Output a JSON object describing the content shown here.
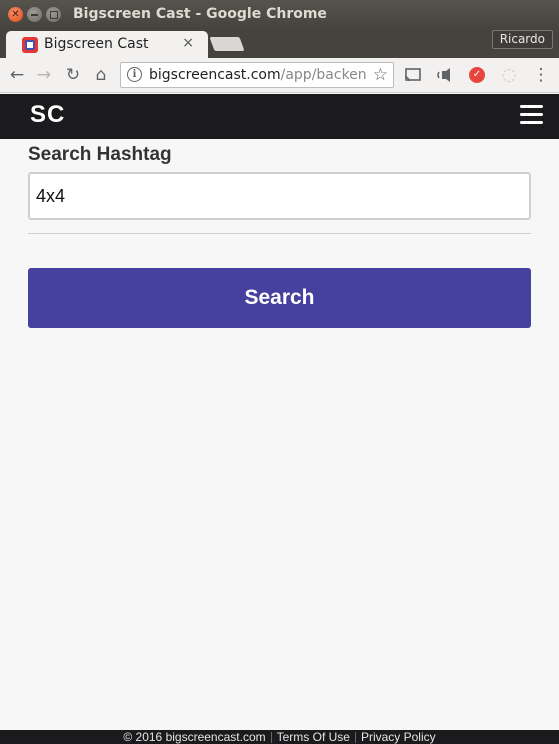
{
  "window": {
    "title": "Bigscreen Cast - Google Chrome",
    "close_glyph": "✕"
  },
  "tab": {
    "title": "Bigscreen Cast",
    "close_glyph": "×",
    "favicon": "bigscreen-cast-favicon"
  },
  "profile": {
    "name": "Ricardo"
  },
  "toolbar": {
    "back_glyph": "←",
    "forward_glyph": "→",
    "reload_glyph": "↻",
    "home_glyph": "⌂",
    "url_domain": "bigscreencast.com",
    "url_path": "/app/backend/fo",
    "star_glyph": "☆",
    "cast_glyph": "▭",
    "media_glyph": "◖",
    "ext1_glyph": "✓",
    "ext2_glyph": "◌",
    "menu_glyph": "⋮"
  },
  "navbar": {
    "brand": "SC"
  },
  "form": {
    "label": "Search Hashtag",
    "input_value": "4x4",
    "button_label": "Search"
  },
  "footer": {
    "copyright": "© 2016 bigscreencast.com",
    "terms": "Terms Of Use",
    "privacy": "Privacy Policy"
  },
  "colors": {
    "button": "#46409e",
    "navbar": "#1b1b1d",
    "page_background": "#f7f7f7"
  }
}
